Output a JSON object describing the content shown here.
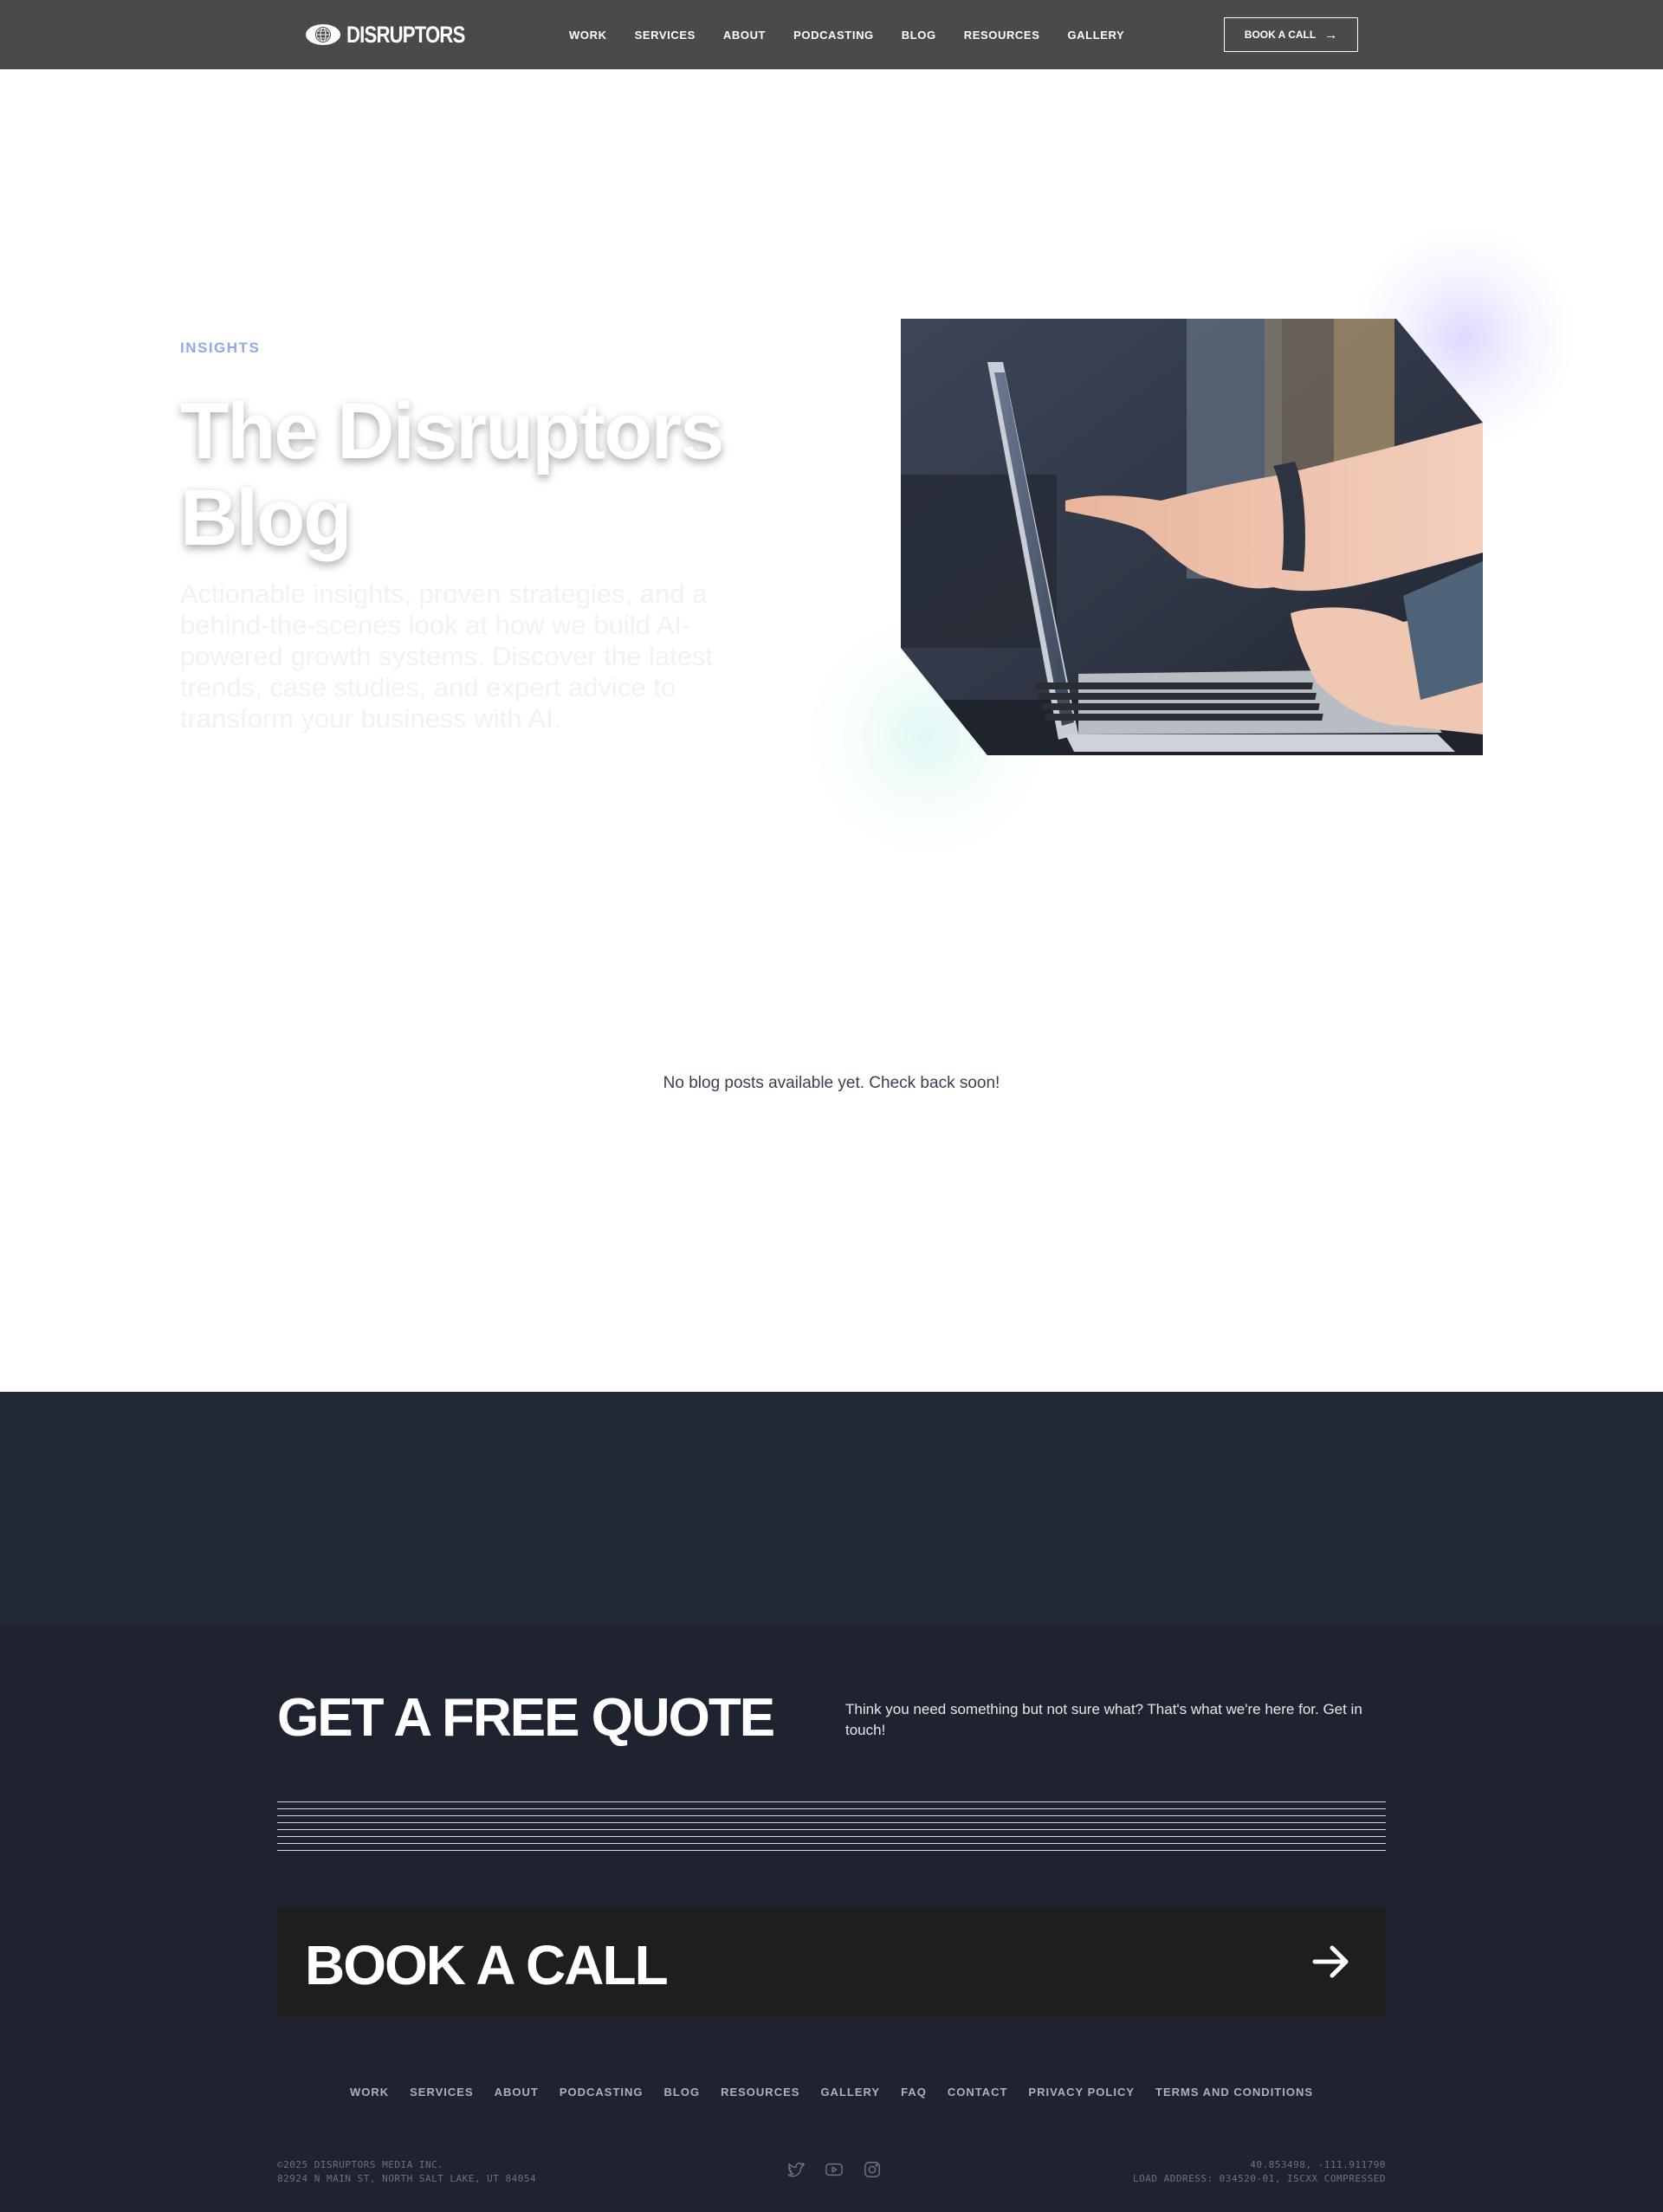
{
  "nav": {
    "logo_text": "DISRUPTORS",
    "links": [
      "WORK",
      "SERVICES",
      "ABOUT",
      "PODCASTING",
      "BLOG",
      "RESOURCES",
      "GALLERY"
    ],
    "cta_label": "BOOK A CALL"
  },
  "hero": {
    "eyebrow": "INSIGHTS",
    "title": "The Disruptors Blog",
    "subtitle": "Actionable insights, proven strategies, and a behind-the-scenes look at how we build AI-powered growth systems. Discover the latest trends, case studies, and expert advice to transform your business with AI."
  },
  "blog": {
    "empty_message": "No blog posts available yet. Check back soon!"
  },
  "footer": {
    "quote_title": "GET A FREE QUOTE",
    "quote_text": "Think you need something but not sure what? That's what we're here for. Get in touch!",
    "book_label": "BOOK A CALL",
    "links": [
      "WORK",
      "SERVICES",
      "ABOUT",
      "PODCASTING",
      "BLOG",
      "RESOURCES",
      "GALLERY",
      "FAQ",
      "CONTACT",
      "PRIVACY POLICY",
      "TERMS AND CONDITIONS"
    ],
    "copyright": "©2025 DISRUPTORS MEDIA INC.",
    "address": "82924 N MAIN ST, NORTH SALT LAKE, UT 84054",
    "coordinates": "40.853498, -111.911790",
    "load_address": "LOAD ADDRESS: 034520-01, ISCXX COMPRESSED",
    "socials": [
      "twitter-icon",
      "youtube-icon",
      "instagram-icon"
    ]
  },
  "colors": {
    "nav_bg": "#4a4a48",
    "eyebrow": "#93a8ec",
    "dark_band": "#212836",
    "footer_bg": "#1f2330",
    "book_bar": "#1e1e1e"
  }
}
